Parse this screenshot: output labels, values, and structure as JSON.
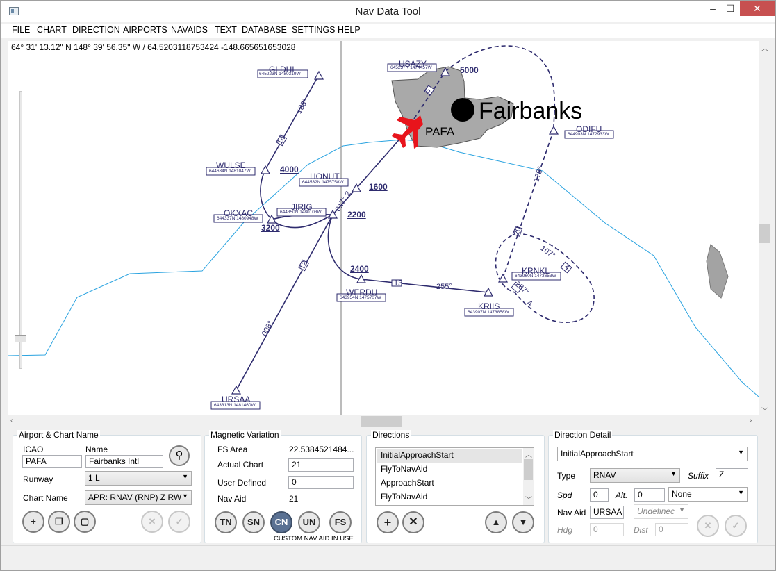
{
  "window": {
    "title": "Nav Data Tool",
    "min": "‒",
    "max": "☐",
    "close": "✕"
  },
  "menu": [
    "FILE",
    "CHART",
    "DIRECTION",
    "AIRPORTS",
    "NAVAIDS",
    "TEXT",
    "DATABASE",
    "SETTINGS",
    "HELP"
  ],
  "coordinates": "64° 31' 13.12\" N 148° 39' 56.35\" W / 64.5203118753424 -148.665651653028",
  "map": {
    "city": "Fairbanks",
    "airport": "PAFA",
    "fixes": [
      {
        "name": "GLDHL",
        "code": "645223N 1480319W"
      },
      {
        "name": "USAZY",
        "code": "645237N 1474457W"
      },
      {
        "name": "ODIFU",
        "code": "644903N 1472933W"
      },
      {
        "name": "WULSE",
        "code": "644634N 1481047W"
      },
      {
        "name": "HONUT",
        "code": "644532N 1475758W"
      },
      {
        "name": "OKXAC",
        "code": "644337N 1480948W"
      },
      {
        "name": "JIRIG",
        "code": "644350N 1480103W"
      },
      {
        "name": "WERDU",
        "code": "643954N 1475707W"
      },
      {
        "name": "KRNKL",
        "code": "643960N 1473653W"
      },
      {
        "name": "KRIIS",
        "code": "643907N 1473858W"
      },
      {
        "name": "URSAA",
        "code": "643313N 1481460W"
      }
    ],
    "altitudes": [
      "5000",
      "4000",
      "1600",
      "3200",
      "2200",
      "2400"
    ],
    "courses": [
      "188°",
      "14",
      "178°",
      "20",
      "107°",
      "4",
      "287°",
      "4",
      "255°",
      "13",
      "017°",
      "2",
      "008°",
      "12",
      "6"
    ]
  },
  "airport_group": {
    "title": "Airport & Chart Name",
    "icao_label": "ICAO",
    "name_label": "Name",
    "icao": "PAFA",
    "name": "Fairbanks Intl",
    "runway_label": "Runway",
    "runway": "1 L",
    "chart_label": "Chart Name",
    "chart": "APR: RNAV (RNP) Z RW",
    "search_icon": "⚲",
    "btn_add": "+",
    "btn_copy": "❐",
    "btn_new": "▢",
    "btn_del": "✕",
    "btn_save": "✓"
  },
  "magvar_group": {
    "title": "Magnetic Variation",
    "fs_label": "FS Area",
    "fs_value": "22.5384521484...",
    "actual_label": "Actual Chart",
    "actual_value": "21",
    "user_label": "User Defined",
    "user_value": "0",
    "navaid_label": "Nav Aid",
    "navaid_value": "21",
    "buttons": [
      "TN",
      "SN",
      "CN",
      "UN",
      "FS"
    ],
    "caption": "CUSTOM NAV AID IN USE"
  },
  "directions_group": {
    "title": "Directions",
    "items": [
      "InitialApproachStart",
      "FlyToNavAid",
      "ApproachStart",
      "FlyToNavAid"
    ],
    "add": "+",
    "remove": "✕",
    "up": "▲",
    "down": "▼"
  },
  "detail_group": {
    "title": "Direction Detail",
    "selected": "InitialApproachStart",
    "type_label": "Type",
    "type": "RNAV",
    "suffix_label": "Suffix",
    "suffix": "Z",
    "spd_label": "Spd",
    "spd": "0",
    "alt_label": "Alt.",
    "alt": "0",
    "alt_mode": "None",
    "navaid_label": "Nav Aid",
    "navaid": "URSAA",
    "navaid_type": "Undefinec",
    "hdg_label": "Hdg",
    "hdg": "0",
    "dist_label": "Dist",
    "dist": "0",
    "btn_del": "✕",
    "btn_save": "✓"
  },
  "colors": {
    "route": "#2e2b6e",
    "coast": "#2aa3e0",
    "city_fill": "#a9a9a9",
    "aircraft": "#e8141c"
  }
}
